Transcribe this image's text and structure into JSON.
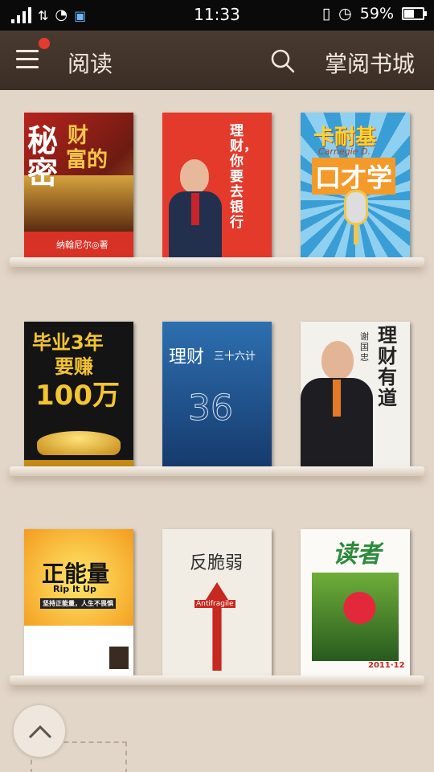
{
  "status_bar": {
    "time": "11:33",
    "battery": "59%",
    "battery_level": 0.59
  },
  "header": {
    "menu_icon": "menu-icon",
    "title": "阅读",
    "search_icon": "search-icon",
    "store_link": "掌阅书城"
  },
  "books": [
    {
      "lines": [
        "财",
        "富的",
        "秘",
        "密"
      ],
      "author": "纳翰尼尔◎著"
    },
    {
      "lines": [
        "理财，你要去银行"
      ]
    },
    {
      "lines": [
        "卡耐基",
        "Carnegie D.",
        "口才学"
      ]
    },
    {
      "lines": [
        "毕业3年",
        "要赚",
        "100万"
      ]
    },
    {
      "lines": [
        "理财",
        "三十六计",
        "36"
      ]
    },
    {
      "lines": [
        "理财有道",
        "谢国忠",
        "理财"
      ]
    },
    {
      "lines": [
        "正能量",
        "Rip It Up",
        "坚持正能量，人生不畏惧"
      ]
    },
    {
      "lines": [
        "反脆弱",
        "Antifragile"
      ]
    },
    {
      "lines": [
        "读者",
        "2011·12"
      ]
    }
  ]
}
